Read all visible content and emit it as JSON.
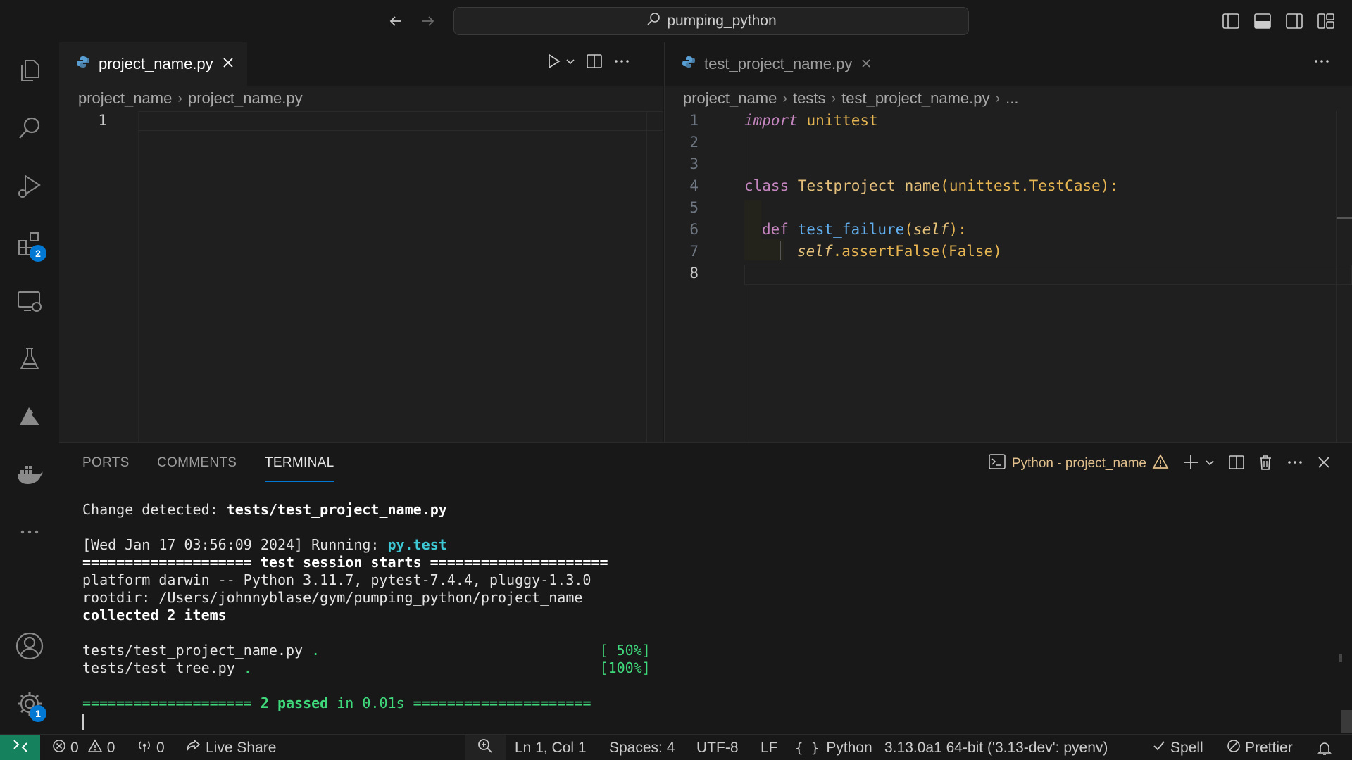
{
  "title_bar": {
    "search_text": "pumping_python"
  },
  "activity_bar": {
    "extensions_badge": "2",
    "settings_badge": "1"
  },
  "editor_left": {
    "tab_label": "project_name.py",
    "breadcrumb": [
      "project_name",
      "project_name.py"
    ],
    "line_numbers": [
      "1"
    ]
  },
  "editor_right": {
    "tab_label": "test_project_name.py",
    "breadcrumb": [
      "project_name",
      "tests",
      "test_project_name.py",
      "..."
    ],
    "line_numbers": [
      "1",
      "2",
      "3",
      "4",
      "5",
      "6",
      "7",
      "8"
    ],
    "code": {
      "l1_import": "import",
      "l1_module": "unittest",
      "l4_class": "class",
      "l4_name": "Testproject_name",
      "l4_base": "(unittest.TestCase):",
      "l6_def": "def",
      "l6_fn": "test_failure",
      "l6_open": "(",
      "l6_self": "self",
      "l6_close": "):",
      "l7_self": "self",
      "l7_call": ".assertFalse(False)"
    }
  },
  "panel": {
    "tabs": [
      "PORTS",
      "COMMENTS",
      "TERMINAL"
    ],
    "terminal_name": "Python - project_name",
    "terminal": {
      "change_prefix": "Change detected: ",
      "change_file": "tests/test_project_name.py",
      "running_prefix": "[Wed Jan 17 03:56:09 2024] Running: ",
      "running_cmd": "py.test",
      "session_line": "==================== test session starts =====================",
      "platform_line": "platform darwin -- Python 3.11.7, pytest-7.4.4, pluggy-1.3.0",
      "rootdir_line": "rootdir: /Users/johnnyblase/gym/pumping_python/project_name",
      "collected_line": "collected 2 items",
      "result1_file": "tests/test_project_name.py ",
      "result1_dot": ".",
      "result1_pct": "[ 50%]",
      "result2_file": "tests/test_tree.py ",
      "result2_dot": ".",
      "result2_pct": "[100%]",
      "summary_left": "==================== ",
      "summary_passed": "2 passed",
      "summary_mid": " in 0.01s ",
      "summary_right": "====================="
    }
  },
  "status_bar": {
    "errors": "0",
    "warnings": "0",
    "ports": "0",
    "live_share": "Live Share",
    "position": "Ln 1, Col 1",
    "spaces": "Spaces: 4",
    "encoding": "UTF-8",
    "eol": "LF",
    "language": "Python",
    "interpreter": "3.13.0a1 64-bit ('3.13-dev': pyenv)",
    "spell": "Spell",
    "prettier": "Prettier"
  },
  "colors": {
    "accent": "#0078d4",
    "remote": "#16825d",
    "warning": "#e2c08d",
    "terminal_green": "#3fd97b",
    "terminal_cyan": "#3ec7d4"
  }
}
